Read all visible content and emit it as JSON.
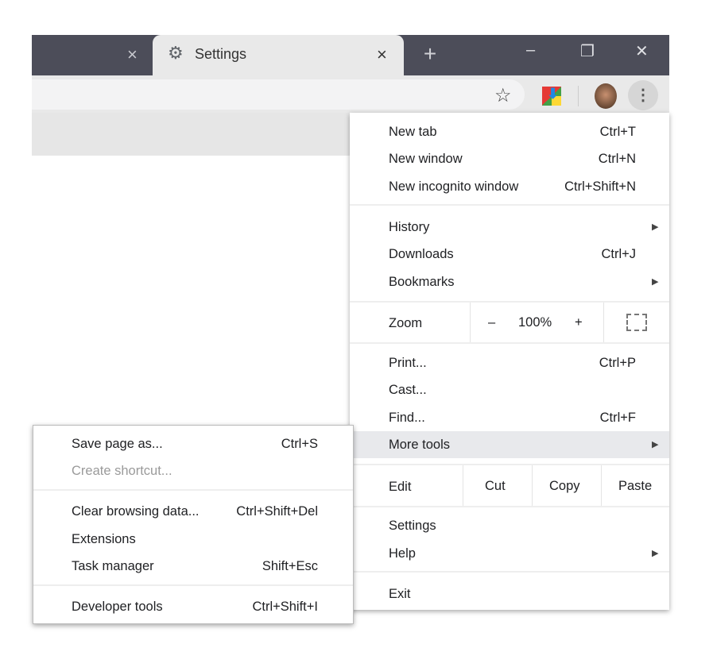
{
  "tabs": [
    {
      "label": "",
      "close": "×"
    },
    {
      "label": "Settings",
      "icon": "gear-icon",
      "close": "×",
      "active": true
    }
  ],
  "new_tab": "+",
  "window": {
    "minimize": "–",
    "restore": "❐",
    "close": "✕"
  },
  "toolbar": {
    "star": "☆",
    "menu": "⋮"
  },
  "menu": {
    "new_tab": {
      "label": "New tab",
      "shortcut": "Ctrl+T"
    },
    "new_window": {
      "label": "New window",
      "shortcut": "Ctrl+N"
    },
    "incognito": {
      "label": "New incognito window",
      "shortcut": "Ctrl+Shift+N"
    },
    "history": {
      "label": "History"
    },
    "downloads": {
      "label": "Downloads",
      "shortcut": "Ctrl+J"
    },
    "bookmarks": {
      "label": "Bookmarks"
    },
    "zoom": {
      "label": "Zoom",
      "minus": "–",
      "value": "100%",
      "plus": "+"
    },
    "print": {
      "label": "Print...",
      "shortcut": "Ctrl+P"
    },
    "cast": {
      "label": "Cast..."
    },
    "find": {
      "label": "Find...",
      "shortcut": "Ctrl+F"
    },
    "more_tools": {
      "label": "More tools"
    },
    "edit": {
      "label": "Edit",
      "cut": "Cut",
      "copy": "Copy",
      "paste": "Paste"
    },
    "settings": {
      "label": "Settings"
    },
    "help": {
      "label": "Help"
    },
    "exit": {
      "label": "Exit"
    }
  },
  "submenu": {
    "save_page": {
      "label": "Save page as...",
      "shortcut": "Ctrl+S"
    },
    "create_shortcut": {
      "label": "Create shortcut..."
    },
    "clear_data": {
      "label": "Clear browsing data...",
      "shortcut": "Ctrl+Shift+Del"
    },
    "extensions": {
      "label": "Extensions"
    },
    "task_manager": {
      "label": "Task manager",
      "shortcut": "Shift+Esc"
    },
    "dev_tools": {
      "label": "Developer tools",
      "shortcut": "Ctrl+Shift+I"
    }
  },
  "colors": {
    "tabstrip": "#4c4d59",
    "highlight": "#e8e9ec"
  }
}
